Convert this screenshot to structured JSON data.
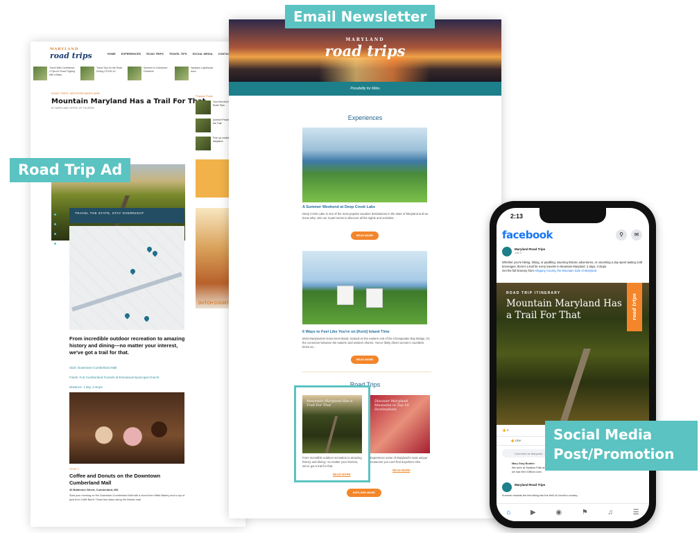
{
  "labels": {
    "road_trip_ad": "Road Trip Ad",
    "email_newsletter": "Email Newsletter",
    "social_media": "Social Media\nPost/Promotion"
  },
  "blog": {
    "logo": "road trips",
    "logo_small": "MARYLAND",
    "menu": [
      "HOME",
      "EXPERIENCES",
      "ROAD TRIPS",
      "TRAVEL TIPS",
      "SOCIAL MEDIA",
      "CONTACT"
    ],
    "thumbs": [
      "Travel With Confidence: 4 Tips for Road Tripping with a Baby",
      "Travel Tips for the Road During COVID-19",
      "Summer In Downtown Frederick",
      "Hampton Lighthouse Area"
    ],
    "kicker": "ROAD TRIPS, WESTERN MARYLAND",
    "title": "Mountain Maryland Has a Trail For That",
    "byline": "BY MARYLAND OFFICE OF TOURISM",
    "sidebar_heading": "Popular Posts",
    "sidebar_items": [
      "Your first visit to Maryland Road Trips",
      "Achieve Peace of Mind on the Trail",
      "Pour up cocktails around Maryland"
    ],
    "banner": "TRAVEL THE STATE, STAY OVERNIGHT",
    "lead": "From incredible outdoor recreation to amazing history and dining—no matter your interest, we've got a trail for that.",
    "links": [
      "Start: Downtown Cumberland Mall",
      "Finish: Fort Cumberland Tunnels at Emmanuel Episcopal Church",
      "Distance: 1 day, 3 stops"
    ],
    "ad_footer": "DUTCH COUNTRY",
    "step": "STOP 1",
    "h2": "Coffee and Donuts on the Downtown Cumberland Mall",
    "addr": "40 Baltimore Street, Cumberland, MD",
    "body": "Start your morning on the Downtown Cumberland Mall with a donut from Mikie Bakery and a cup of java from Caffe Bardi. These two stops along the historic mall"
  },
  "email": {
    "logo_small": "MARYLAND",
    "logo": "road trips",
    "tagline": "Possibility for Miles",
    "section1": "Experiences",
    "card1_title": "A Summer Weekend at Deep Creek Lake",
    "card1_text": "Deep Creek Lake is one of the most popular vacation destinations in the state of Maryland and we know why! Join our 3-part series to discover all the sights and activities...",
    "btn": "READ MORE",
    "card2_title": "6 Ways to Feel Like You're on [Kent] Island Time",
    "card2_text": "Most Marylanders know Kent Island, located on the eastern end of the Chesapeake Bay Bridge, it's the connector between the eastern and western shores. You've likely driven across it countless times as...",
    "section2": "Road Trips",
    "rt1_cap": "Mountain Maryland Has a Trail For That",
    "rt1_text": "From incredible outdoor recreation to amazing history and dining—no matter your interest, we've got a trail for that.",
    "rt2_cap": "Discover Maryland Museums in Top 10 Destinations",
    "rt2_text": "Experience some of Maryland's most unique museums you can't find anywhere else.",
    "read_more": "READ MORE",
    "explore": "EXPLORE MORE"
  },
  "phone": {
    "time": "2:13",
    "app": "facebook",
    "page_name": "Maryland Road Trips",
    "date": "July 27",
    "text": "Whether you're biking, hiking, or paddling, savoring historic adventures, or uncorking a day spent tasting craft beverages, there's a trail for every traveler in Mountain Maryland. 2 days, 3 stops.",
    "text_link_intro": "Get the full itinerary from",
    "text_link": "Allegany County, the Mountain Side of Maryland",
    "kick": "ROAD TRIP ITINERARY",
    "title": "Mountain Maryland Has a Trail For That",
    "vtag": "road trips",
    "reacts": "2",
    "like": "Like",
    "comment_placeholder": "Comment as Maryland...",
    "reply_name": "Mary Gray Buntier",
    "reply_text": "We were at Swallow Falls and Dan's from a few weeks ago. Stayed at the Long Branch Saloon Hotel in Oakland, we had Meri Gifford room.",
    "post2_name": "Maryland Road Trips",
    "post2_text": "Summer rewards the few hiking into the thrill of Lincoln's country..."
  }
}
